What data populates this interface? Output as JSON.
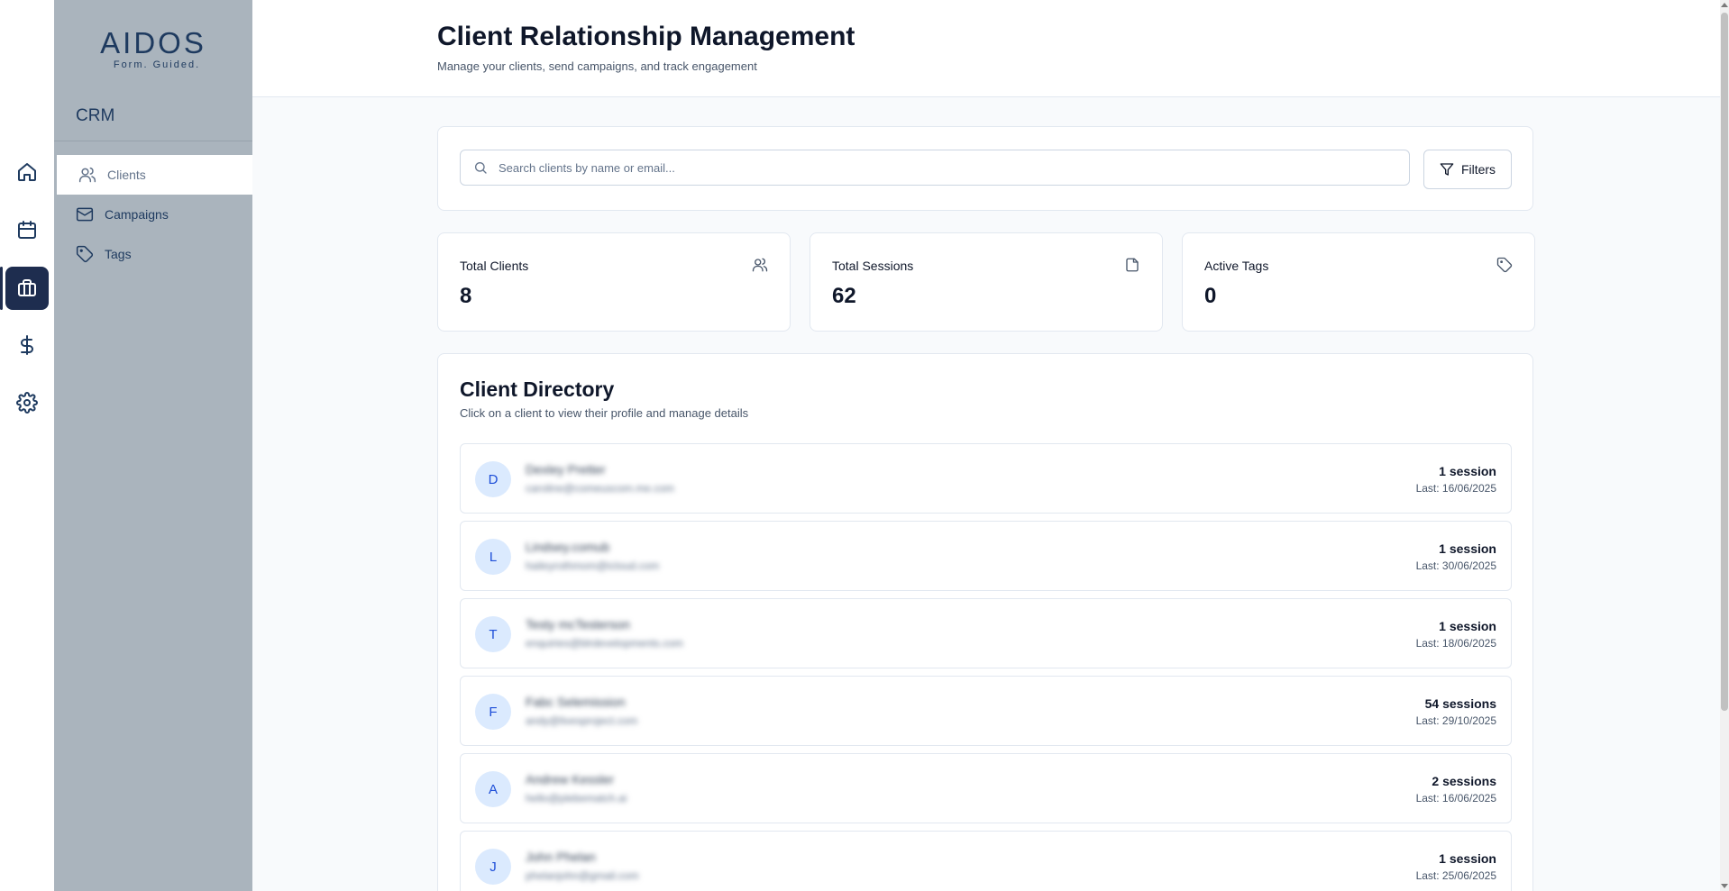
{
  "sidebar": {
    "logo_main": "AIDOS",
    "logo_sub": "Form. Guided.",
    "section_title": "CRM",
    "items": [
      {
        "label": "Clients"
      },
      {
        "label": "Campaigns"
      },
      {
        "label": "Tags"
      }
    ]
  },
  "rail": {
    "icons": [
      "home-icon",
      "calendar-icon",
      "briefcase-icon",
      "dollar-icon",
      "gear-icon"
    ],
    "active": "briefcase-icon"
  },
  "header": {
    "title": "Client Relationship Management",
    "subtitle": "Manage your clients, send campaigns, and track engagement"
  },
  "search": {
    "placeholder": "Search clients by name or email...",
    "value": "",
    "filters_label": "Filters"
  },
  "stats": [
    {
      "label": "Total Clients",
      "value": "8",
      "icon": "users-icon"
    },
    {
      "label": "Total Sessions",
      "value": "62",
      "icon": "file-icon"
    },
    {
      "label": "Active Tags",
      "value": "0",
      "icon": "tag-icon"
    }
  ],
  "directory": {
    "title": "Client Directory",
    "subtitle": "Click on a client to view their profile and manage details",
    "clients": [
      {
        "initial": "D",
        "name": "Dexley Pretter",
        "email": "caroline@comeuscom.me.com",
        "sessions": "1 session",
        "last": "Last: 16/06/2025"
      },
      {
        "initial": "L",
        "name": "Lindsey.comub",
        "email": "haileyrothmom@icloud.com",
        "sessions": "1 session",
        "last": "Last: 30/06/2025"
      },
      {
        "initial": "T",
        "name": "Testy mcTesterson",
        "email": "enquiries@blrdevelopments.com",
        "sessions": "1 session",
        "last": "Last: 18/06/2025"
      },
      {
        "initial": "F",
        "name": "Fabc Selemission",
        "email": "andy@livesproject.com",
        "sessions": "54 sessions",
        "last": "Last: 29/10/2025"
      },
      {
        "initial": "A",
        "name": "Andrew Kessler",
        "email": "hello@plebematch.ai",
        "sessions": "2 sessions",
        "last": "Last: 16/06/2025"
      },
      {
        "initial": "J",
        "name": "John Phelan",
        "email": "phelanjohn@gmail.com",
        "sessions": "1 session",
        "last": "Last: 25/06/2025"
      }
    ]
  },
  "colors": {
    "accent": "#1e2d4f",
    "sidebar_bg": "#aab4bd",
    "avatar_bg": "#dbeafe",
    "avatar_text": "#1d4ed8"
  }
}
